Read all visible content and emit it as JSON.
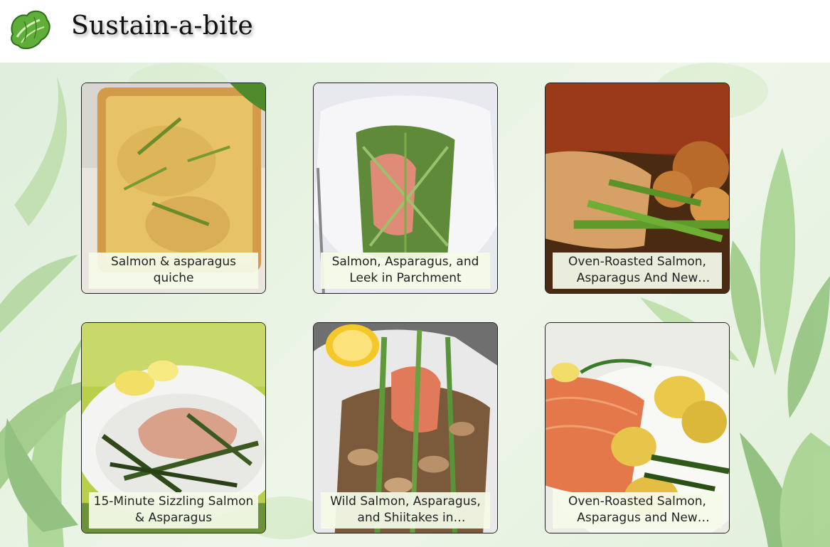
{
  "app": {
    "title": "Sustain-a-bite",
    "logo_icon": "lettuce-icon"
  },
  "recipes": [
    {
      "title": "Salmon & asparagus quiche",
      "image": "quiche-photo"
    },
    {
      "title": "Salmon, Asparagus, and Leek in Parchment",
      "image": "parchment-salmon-photo"
    },
    {
      "title": "Oven-Roasted Salmon, Asparagus And New Potatoes",
      "image": "roasted-salmon-potatoes-photo"
    },
    {
      "title": "15-Minute Sizzling Salmon & Asparagus",
      "image": "sizzling-salmon-photo"
    },
    {
      "title": "Wild Salmon, Asparagus, and Shiitakes in Parchment",
      "image": "salmon-shiitake-photo"
    },
    {
      "title": "Oven-Roasted Salmon, Asparagus and New Potatoes",
      "image": "salmon-dill-potatoes-photo"
    }
  ],
  "colors": {
    "background": "#e6f2e0",
    "caption_bg": "#f4fae8",
    "leaf": "#5c9e3e"
  }
}
